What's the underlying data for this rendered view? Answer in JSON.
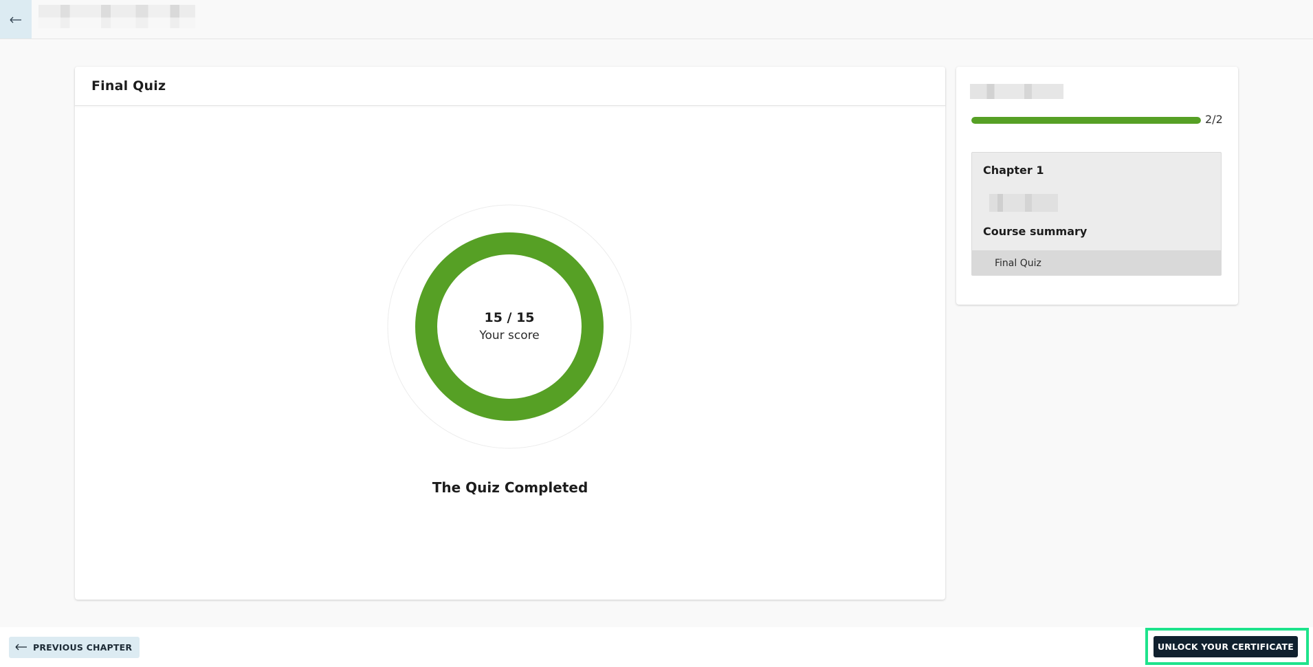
{
  "header": {
    "back_icon": "arrow-left-icon"
  },
  "quiz": {
    "title": "Final Quiz",
    "score_value": "15 / 15",
    "score_label": "Your score",
    "score_fraction": 1.0,
    "completed_text": "The Quiz Completed"
  },
  "sidebar": {
    "progress_fraction": 1.0,
    "progress_text": "2/2",
    "chapter_title": "Chapter 1",
    "summary_title": "Course summary",
    "final_quiz_label": "Final Quiz"
  },
  "footer": {
    "previous_label": "PREVIOUS CHAPTER",
    "previous_icon": "arrow-left-icon",
    "unlock_label": "UNLOCK YOUR CERTIFICATE"
  },
  "colors": {
    "accent_green": "#56a025",
    "dark_button": "#10202e",
    "light_button": "#dcebf2",
    "highlight_outline": "#1ee38c"
  }
}
